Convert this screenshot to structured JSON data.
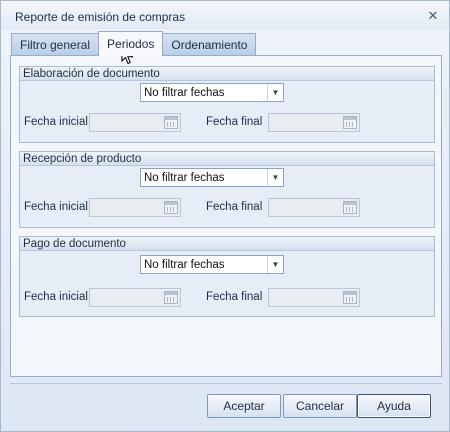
{
  "window": {
    "title": "Reporte de emisión de compras",
    "close_symbol": "✕"
  },
  "tabs": [
    {
      "label": "Filtro general",
      "active": false
    },
    {
      "label": "Periodos",
      "active": true
    },
    {
      "label": "Ordenamiento",
      "active": false
    }
  ],
  "groups": [
    {
      "title": "Elaboración de documento",
      "filter_value": "No filtrar fechas",
      "start_label": "Fecha inicial",
      "end_label": "Fecha final",
      "start_value": "",
      "end_value": ""
    },
    {
      "title": "Recepción de producto",
      "filter_value": "No filtrar fechas",
      "start_label": "Fecha inicial",
      "end_label": "Fecha final",
      "start_value": "",
      "end_value": ""
    },
    {
      "title": "Pago de documento",
      "filter_value": "No filtrar fechas",
      "start_label": "Fecha inicial",
      "end_label": "Fecha final",
      "start_value": "",
      "end_value": ""
    }
  ],
  "buttons": {
    "accept": "Aceptar",
    "cancel": "Cancelar",
    "help": "Ayuda"
  },
  "icons": {
    "close": "close-icon",
    "dropdown": "chevron-down-icon",
    "calendar": "calendar-icon",
    "cursor": "mouse-pointer-icon"
  },
  "colors": {
    "accent": "#3b5377",
    "panel_border": "#97abc8"
  }
}
